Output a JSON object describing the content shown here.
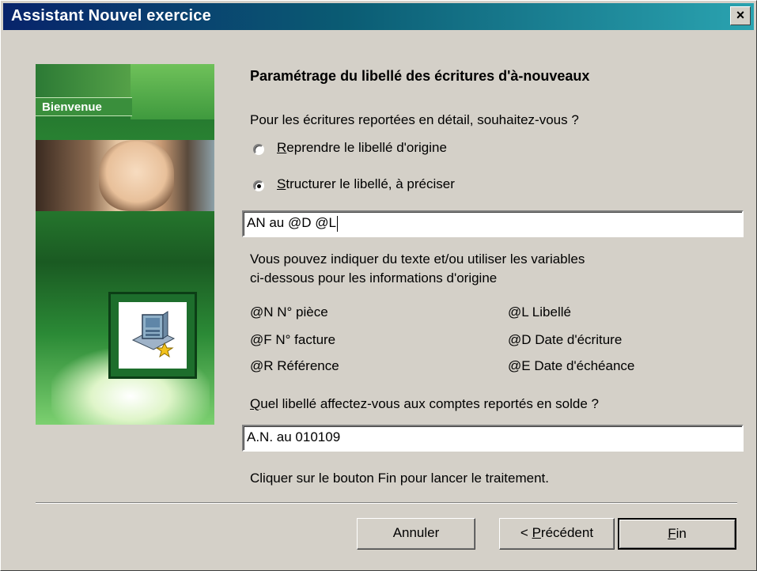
{
  "window": {
    "title": "Assistant Nouvel exercice",
    "close_glyph": "×"
  },
  "sidebar": {
    "banner": "Bienvenue",
    "logo_icon": "computer-wizard-icon",
    "accent_color": "#2d8a35"
  },
  "page": {
    "heading": "Paramétrage du libellé des écritures d'à-nouveaux",
    "question1": "Pour les écritures reportées en détail, souhaitez-vous ?",
    "options": [
      {
        "mnemonic": "R",
        "label_rest": "eprendre le libellé d'origine",
        "selected": false
      },
      {
        "mnemonic": "S",
        "label_rest": "tructurer le libellé, à préciser",
        "selected": true
      }
    ],
    "label_format_value": "AN au @D @L",
    "help_line1": "Vous pouvez indiquer du texte et/ou utiliser les variables",
    "help_line2": "ci-dessous pour les informations d'origine",
    "variables_left": [
      "@N N° pièce",
      "@F N° facture",
      "@R Référence"
    ],
    "variables_right": [
      "@L Libellé",
      "@D Date d'écriture",
      "@E Date d'échéance"
    ],
    "question2_mnemonic": "Q",
    "question2_rest": "uel libellé affectez-vous aux comptes reportés en solde ?",
    "solde_value": "A.N. au 010109",
    "hint": "Cliquer sur le bouton Fin pour lancer le traitement."
  },
  "buttons": {
    "cancel": "Annuler",
    "previous_prefix": "< ",
    "previous_mnemonic": "P",
    "previous_rest": "récédent",
    "finish_mnemonic": "F",
    "finish_rest": "in"
  }
}
